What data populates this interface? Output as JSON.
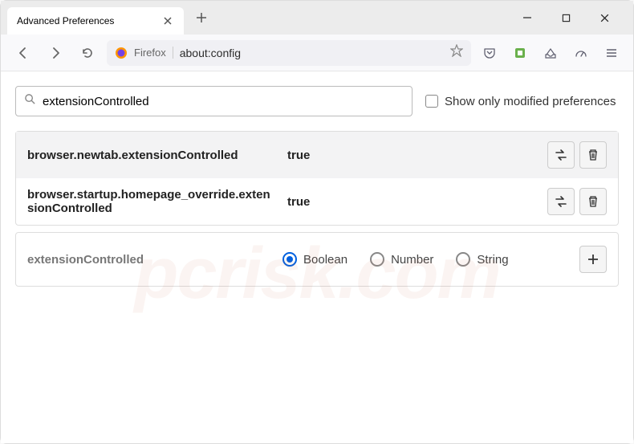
{
  "window": {
    "tab_title": "Advanced Preferences"
  },
  "toolbar": {
    "brand_label": "Firefox",
    "url": "about:config"
  },
  "search": {
    "value": "extensionControlled",
    "checkbox_label": "Show only modified preferences"
  },
  "prefs": [
    {
      "name": "browser.newtab.extensionControlled",
      "value": "true"
    },
    {
      "name": "browser.startup.homepage_override.extensionControlled",
      "value": "true"
    }
  ],
  "new_pref": {
    "name": "extensionControlled",
    "types": [
      "Boolean",
      "Number",
      "String"
    ],
    "selected": "Boolean"
  },
  "watermark": "pcrisk.com"
}
